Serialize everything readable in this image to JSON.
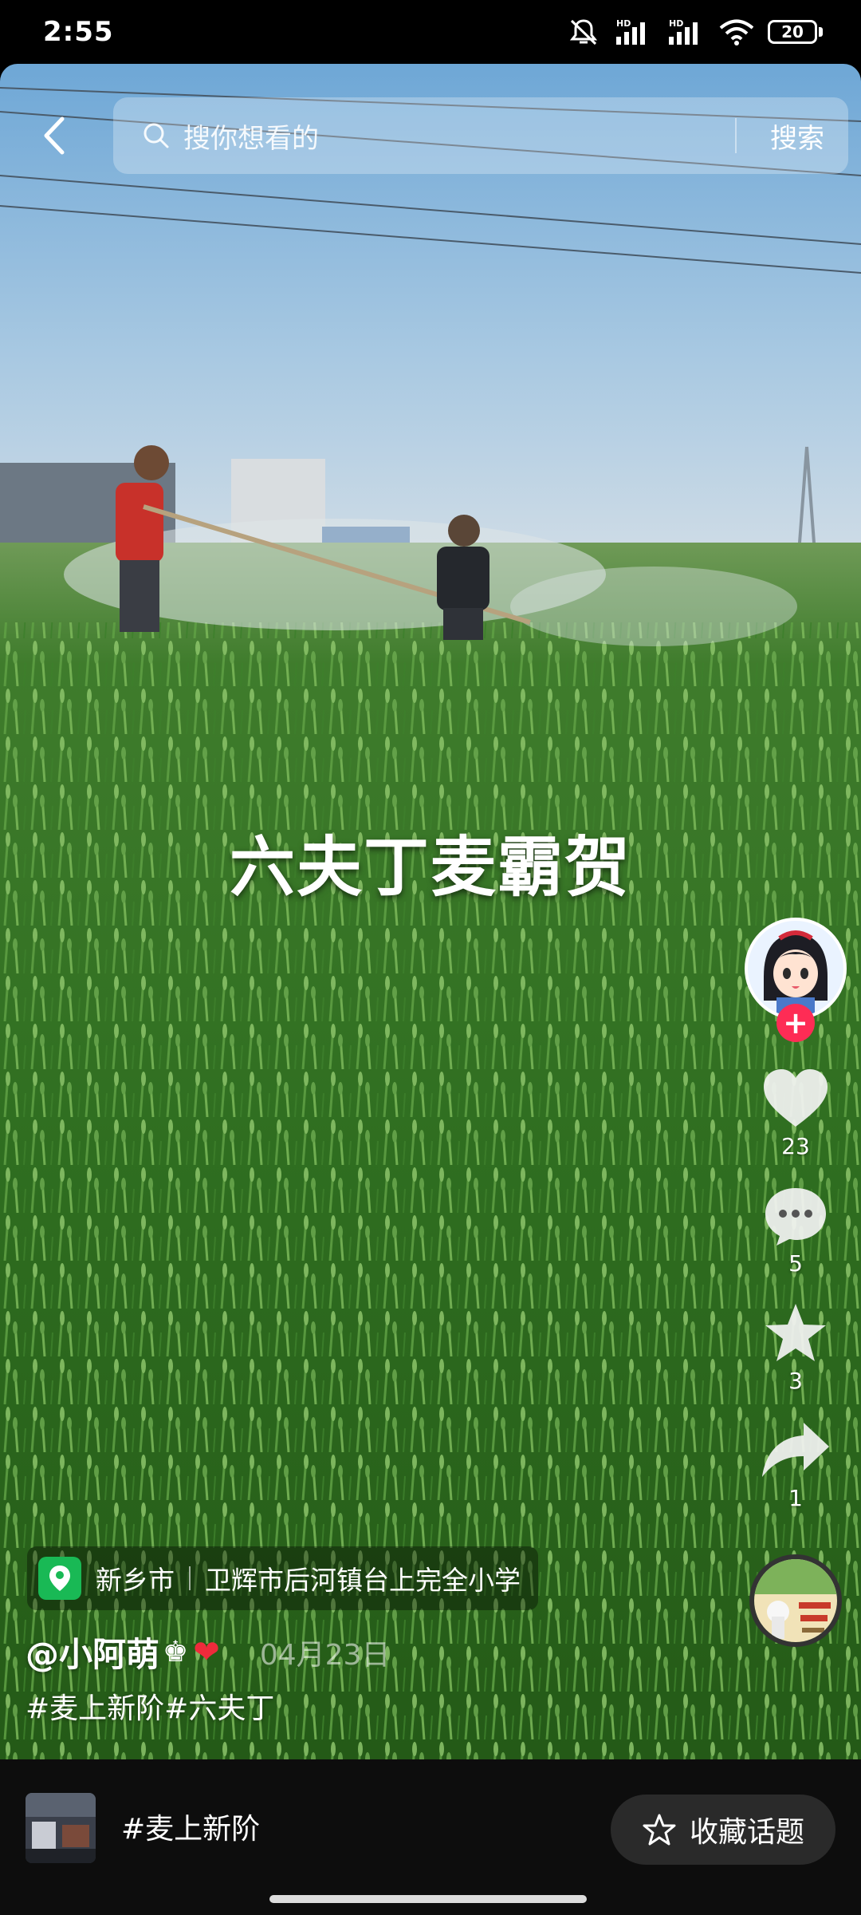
{
  "status_bar": {
    "time": "2:55",
    "battery": "20",
    "icons": [
      "mute-icon",
      "hd-signal-icon",
      "hd-signal-icon",
      "wifi-icon",
      "battery-icon"
    ]
  },
  "search": {
    "placeholder": "搜你想看的",
    "submit_label": "搜索"
  },
  "video": {
    "caption": "六夫丁麦霸贺"
  },
  "actions": {
    "like_count": "23",
    "comment_count": "5",
    "favorite_count": "3",
    "share_count": "1",
    "follow_symbol": "+"
  },
  "info": {
    "location_city": "新乡市",
    "location_place": "卫辉市后河镇台上完全小学",
    "author": "@小阿萌",
    "author_deco": "♚",
    "author_heart": "❤",
    "date": "04月23日",
    "hashtags": "#麦上新阶#六夫丁"
  },
  "bottom_bar": {
    "topic": "#麦上新阶",
    "favorite_topic_label": "收藏话题"
  },
  "colors": {
    "follow_red": "#fe2c55",
    "location_green": "#19b955",
    "bottom_bar_bg": "#0d0d0d"
  }
}
